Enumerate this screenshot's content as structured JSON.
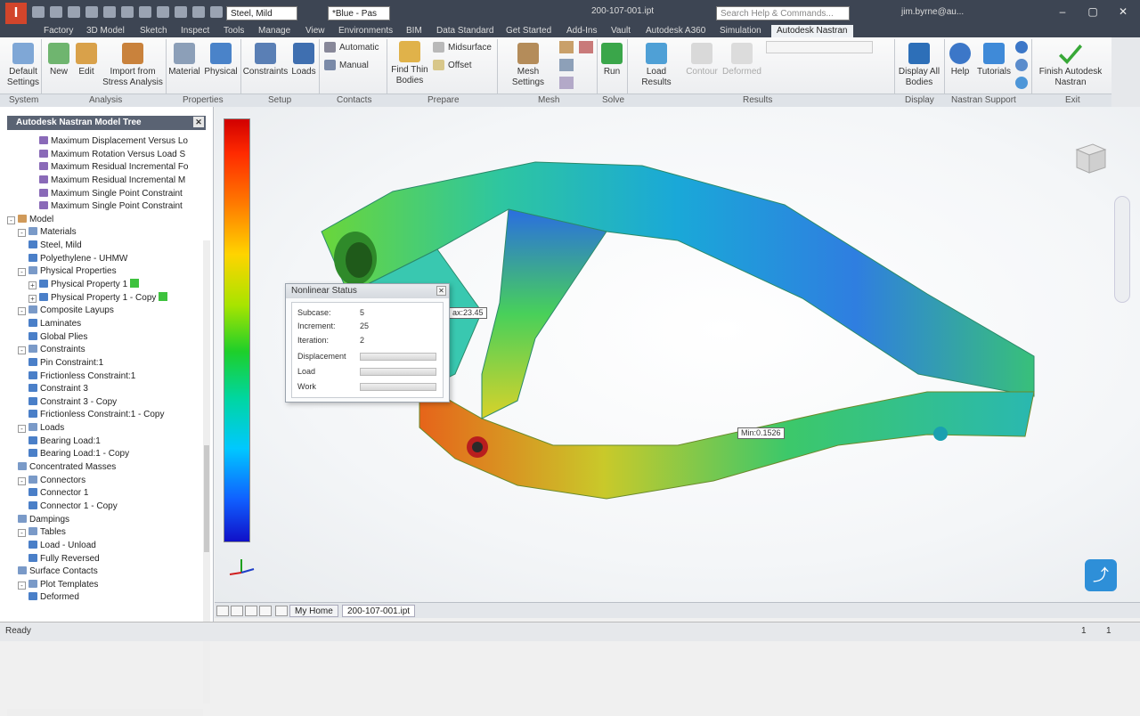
{
  "titlebar": {
    "app_letter": "I",
    "material_select": "Steel, Mild",
    "appearance_select": "*Blue - Pas",
    "file_title": "200-107-001.ipt",
    "search_placeholder": "Search Help & Commands...",
    "user": "jim.byrne@au..."
  },
  "tabs": [
    "Factory",
    "3D Model",
    "Sketch",
    "Inspect",
    "Tools",
    "Manage",
    "View",
    "Environments",
    "BIM",
    "Data Standard",
    "Get Started",
    "Add-Ins",
    "Vault",
    "Autodesk A360",
    "Simulation",
    "Autodesk Nastran"
  ],
  "active_tab": "Autodesk Nastran",
  "ribbon": {
    "default_settings": "Default Settings",
    "new": "New",
    "edit": "Edit",
    "import_stress": "Import from Stress Analysis",
    "material": "Material",
    "physical": "Physical",
    "constraints": "Constraints",
    "loads": "Loads",
    "automatic": "Automatic",
    "manual": "Manual",
    "find_thin": "Find Thin Bodies",
    "midsurface": "Midsurface",
    "offset": "Offset",
    "mesh_settings": "Mesh Settings",
    "run": "Run",
    "load_results": "Load Results",
    "contour": "Contour",
    "deformed": "Deformed",
    "display_all": "Display All Bodies",
    "help": "Help",
    "tutorials": "Tutorials",
    "finish": "Finish Autodesk Nastran"
  },
  "panels": [
    "System",
    "Analysis",
    "Properties",
    "Setup",
    "Contacts",
    "Prepare",
    "Mesh",
    "Solve",
    "Results",
    "Display",
    "Nastran Support",
    "Exit"
  ],
  "browser": {
    "title": "Autodesk Nastran Model Tree",
    "rows": [
      {
        "label": "Maximum Displacement Versus Lo",
        "indent": 3,
        "exp": ""
      },
      {
        "label": "Maximum Rotation Versus Load S",
        "indent": 3,
        "exp": ""
      },
      {
        "label": "Maximum Residual Incremental Fo",
        "indent": 3,
        "exp": ""
      },
      {
        "label": "Maximum Residual Incremental M",
        "indent": 3,
        "exp": ""
      },
      {
        "label": "Maximum Single Point Constraint",
        "indent": 3,
        "exp": ""
      },
      {
        "label": "Maximum Single Point Constraint",
        "indent": 3,
        "exp": ""
      },
      {
        "label": "Model",
        "indent": 0,
        "exp": "-"
      },
      {
        "label": "Materials",
        "indent": 1,
        "exp": "-"
      },
      {
        "label": "Steel, Mild",
        "indent": 2,
        "exp": ""
      },
      {
        "label": "Polyethylene - UHMW",
        "indent": 2,
        "exp": ""
      },
      {
        "label": "Physical Properties",
        "indent": 1,
        "exp": "-"
      },
      {
        "label": "Physical Property 1",
        "indent": 2,
        "exp": "+",
        "badge": true
      },
      {
        "label": "Physical Property 1 - Copy",
        "indent": 2,
        "exp": "+",
        "badge": true
      },
      {
        "label": "Composite Layups",
        "indent": 1,
        "exp": "-"
      },
      {
        "label": "Laminates",
        "indent": 2,
        "exp": ""
      },
      {
        "label": "Global Plies",
        "indent": 2,
        "exp": ""
      },
      {
        "label": "Constraints",
        "indent": 1,
        "exp": "-"
      },
      {
        "label": "Pin Constraint:1",
        "indent": 2,
        "exp": ""
      },
      {
        "label": "Frictionless Constraint:1",
        "indent": 2,
        "exp": ""
      },
      {
        "label": "Constraint 3",
        "indent": 2,
        "exp": ""
      },
      {
        "label": "Constraint 3 - Copy",
        "indent": 2,
        "exp": ""
      },
      {
        "label": "Frictionless Constraint:1 - Copy",
        "indent": 2,
        "exp": ""
      },
      {
        "label": "Loads",
        "indent": 1,
        "exp": "-"
      },
      {
        "label": "Bearing Load:1",
        "indent": 2,
        "exp": ""
      },
      {
        "label": "Bearing Load:1 - Copy",
        "indent": 2,
        "exp": ""
      },
      {
        "label": "Concentrated Masses",
        "indent": 1,
        "exp": ""
      },
      {
        "label": "Connectors",
        "indent": 1,
        "exp": "-"
      },
      {
        "label": "Connector 1",
        "indent": 2,
        "exp": ""
      },
      {
        "label": "Connector 1 - Copy",
        "indent": 2,
        "exp": ""
      },
      {
        "label": "Dampings",
        "indent": 1,
        "exp": ""
      },
      {
        "label": "Tables",
        "indent": 1,
        "exp": "-"
      },
      {
        "label": "Load - Unload",
        "indent": 2,
        "exp": ""
      },
      {
        "label": "Fully Reversed",
        "indent": 2,
        "exp": ""
      },
      {
        "label": "Surface Contacts",
        "indent": 1,
        "exp": ""
      },
      {
        "label": "Plot Templates",
        "indent": 1,
        "exp": "-"
      },
      {
        "label": "Deformed",
        "indent": 2,
        "exp": ""
      }
    ]
  },
  "nonlinear_status": {
    "title": "Nonlinear Status",
    "subcase_label": "Subcase:",
    "subcase_value": "5",
    "increment_label": "Increment:",
    "increment_value": "25",
    "iteration_label": "Iteration:",
    "iteration_value": "2",
    "displacement_label": "Displacement",
    "load_label": "Load",
    "work_label": "Work"
  },
  "labels": {
    "max": "ax:23.45",
    "min": "Min:0.1526"
  },
  "doc_tabs": {
    "home": "My Home",
    "file": "200-107-001.ipt"
  },
  "status": {
    "text": "Ready",
    "num1": "1",
    "num2": "1"
  }
}
